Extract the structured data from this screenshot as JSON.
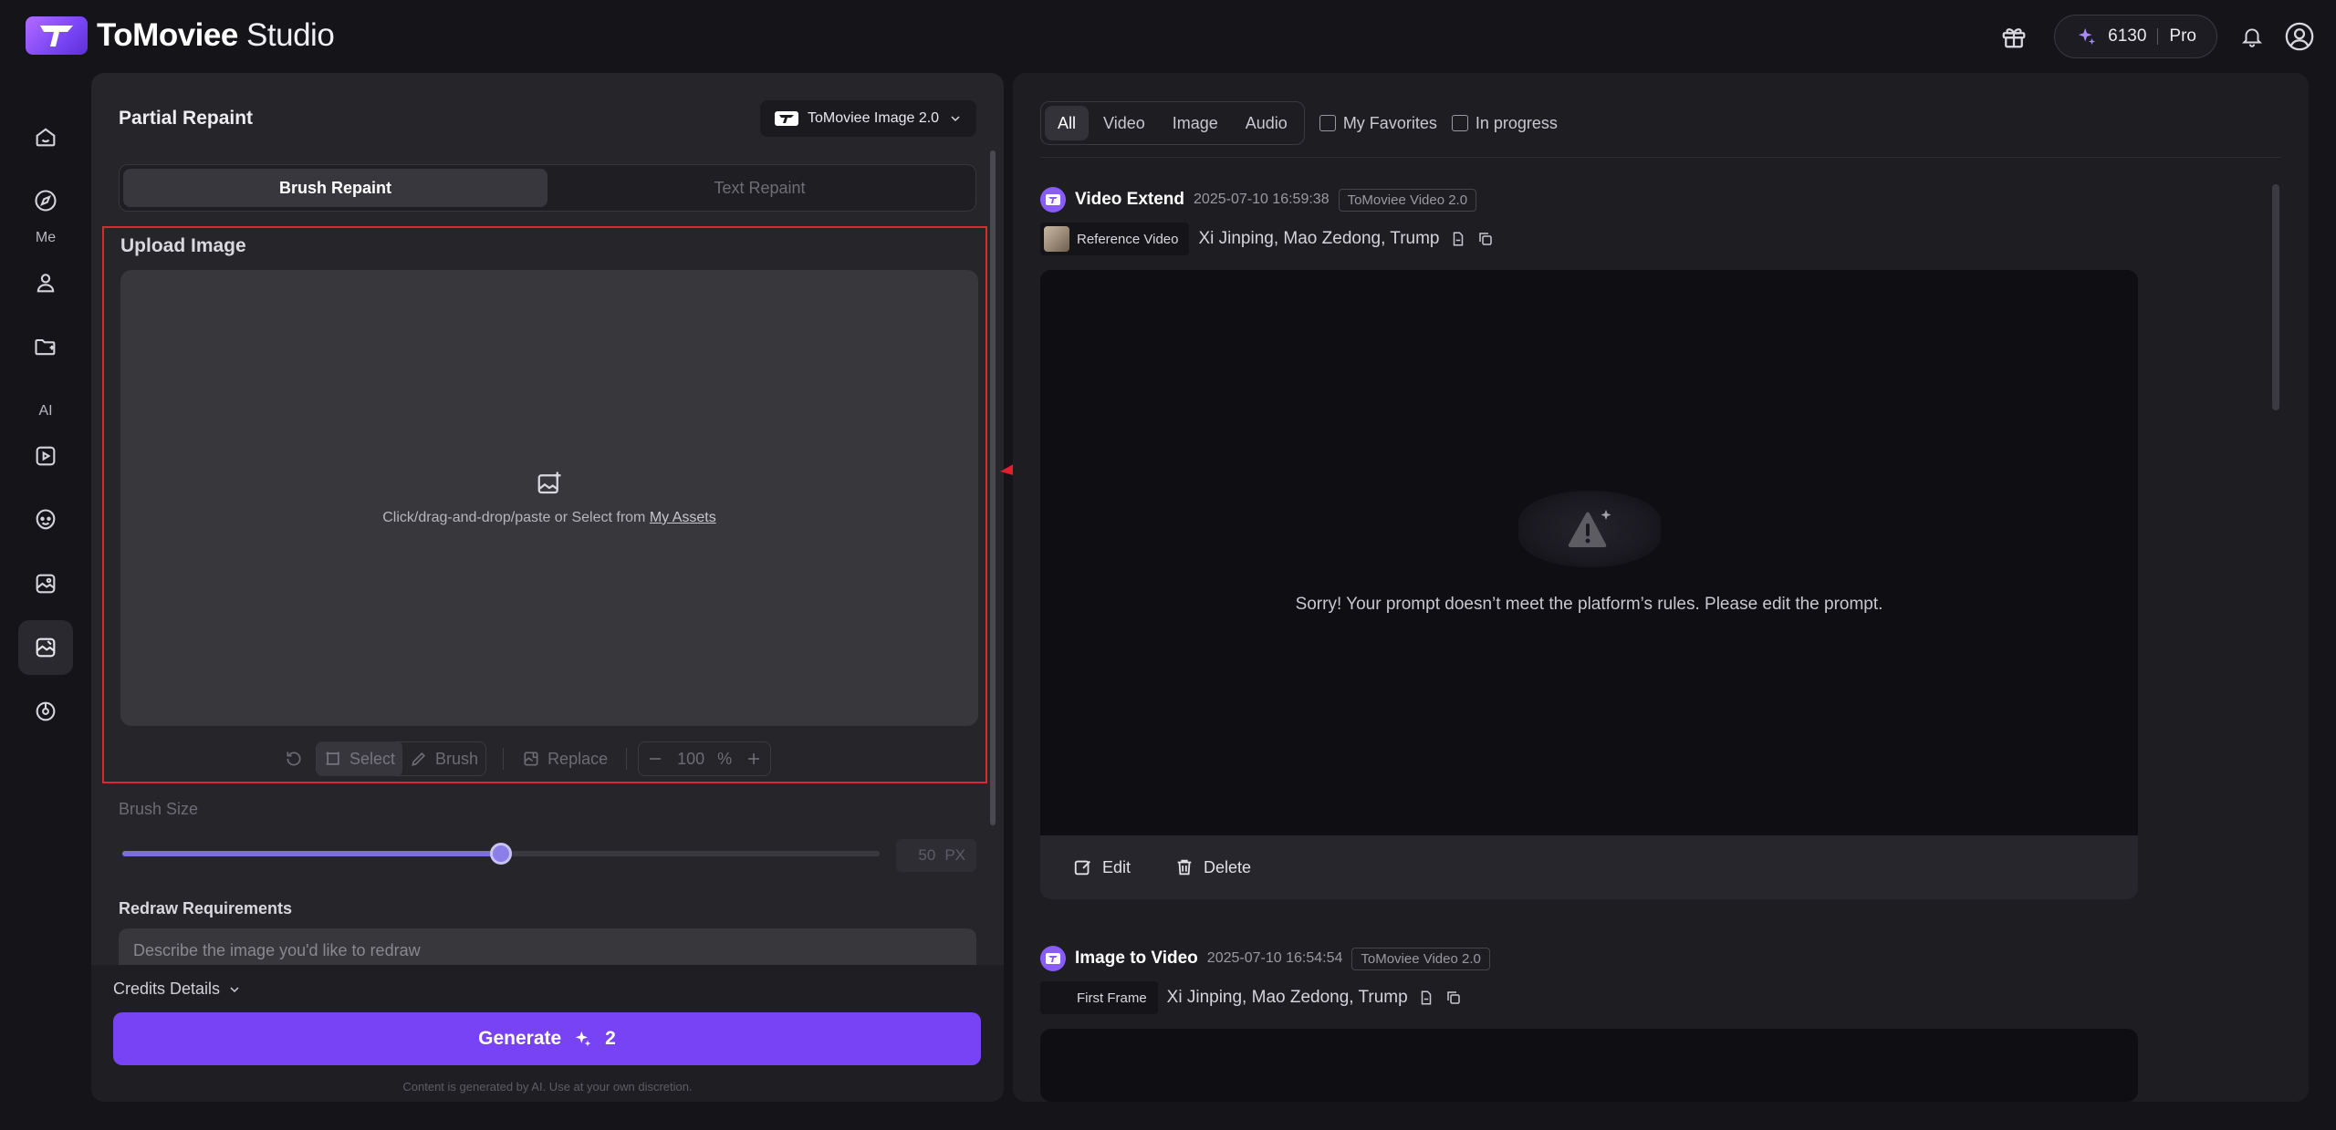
{
  "header": {
    "brand_bold": "ToMoviee",
    "brand_light": " Studio",
    "credits": "6130",
    "plan": "Pro"
  },
  "sidebar": {
    "section_me": "Me",
    "section_ai": "AI"
  },
  "left": {
    "title": "Partial Repaint",
    "model": "ToMoviee Image 2.0",
    "tabs": [
      "Brush Repaint",
      "Text Repaint"
    ],
    "upload_title": "Upload Image",
    "drop_text": "Click/drag-and-drop/paste or Select from ",
    "drop_link": "My Assets",
    "toolbar": {
      "select": "Select",
      "brush": "Brush",
      "replace": "Replace",
      "zoom": "100",
      "zoom_unit": "%"
    },
    "brush_size_label": "Brush Size",
    "brush_size_value": "50",
    "brush_size_unit": "PX",
    "brush_size_fraction": 0.5,
    "redraw_label": "Redraw Requirements",
    "redraw_placeholder": "Describe the image you'd like to redraw",
    "credits_details": "Credits Details",
    "generate_label": "Generate",
    "generate_cost": "2",
    "disclaimer": "Content is generated by AI. Use at your own discretion."
  },
  "right": {
    "filters": [
      "All",
      "Video",
      "Image",
      "Audio"
    ],
    "my_favorites": "My Favorites",
    "in_progress": "In progress",
    "jobs": [
      {
        "name": "Video Extend",
        "time": "2025-07-10 16:59:38",
        "model": "ToMoviee Video 2.0",
        "ref_label": "Reference Video",
        "prompt": "Xi Jinping, Mao Zedong, Trump",
        "error": "Sorry! Your prompt doesn’t meet the platform’s rules. Please edit the prompt.",
        "edit": "Edit",
        "delete": "Delete"
      },
      {
        "name": "Image to Video",
        "time": "2025-07-10 16:54:54",
        "model": "ToMoviee Video 2.0",
        "ref_label": "First Frame",
        "prompt": "Xi Jinping, Mao Zedong, Trump"
      }
    ]
  },
  "colors": {
    "accent": "#7743f4",
    "annotation_red": "#d62b35"
  }
}
